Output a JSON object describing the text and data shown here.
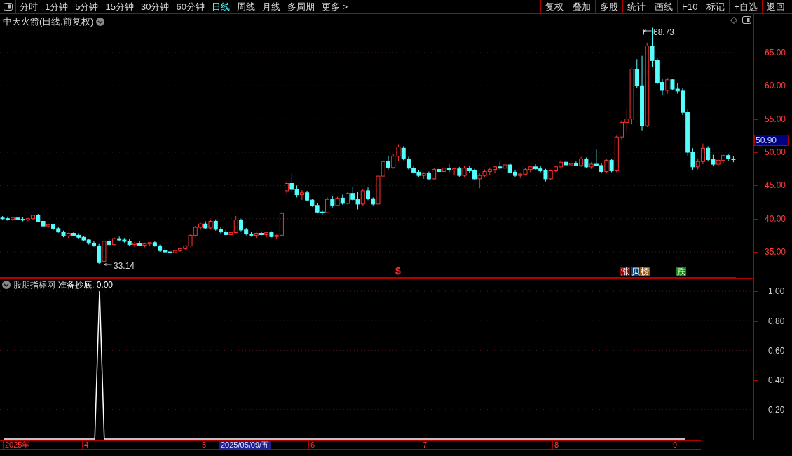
{
  "toolbar": {
    "periods": [
      {
        "label": "分时",
        "selected": false
      },
      {
        "label": "1分钟",
        "selected": false
      },
      {
        "label": "5分钟",
        "selected": false
      },
      {
        "label": "15分钟",
        "selected": false
      },
      {
        "label": "30分钟",
        "selected": false
      },
      {
        "label": "60分钟",
        "selected": false
      },
      {
        "label": "日线",
        "selected": true
      },
      {
        "label": "周线",
        "selected": false
      },
      {
        "label": "月线",
        "selected": false
      },
      {
        "label": "多周期",
        "selected": false
      },
      {
        "label": "更多 >",
        "selected": false
      }
    ],
    "actions": [
      "复权",
      "叠加",
      "多股",
      "统计",
      "画线",
      "F10",
      "标记",
      "+自选",
      "返回"
    ]
  },
  "main_chart": {
    "title": "中天火箭(日线.前复权)",
    "current_price": "50.90",
    "high_label": "68.73",
    "low_label": "33.14",
    "markers": [
      {
        "kind": "plain",
        "text": "$",
        "color": "#ff3030"
      },
      {
        "kind": "badge",
        "text": "涨",
        "color": "#8b0a0a"
      },
      {
        "kind": "badge",
        "text": "贝",
        "color": "#0a3f78"
      },
      {
        "kind": "badge",
        "text": "榜",
        "color": "#a0520a"
      },
      {
        "kind": "badge",
        "text": "跌",
        "color": "#0a8a0a"
      }
    ],
    "chart_data": {
      "type": "candlestick",
      "ylim": [
        31.1,
        70.8
      ],
      "grid": true,
      "yticks": [
        {
          "value": 65,
          "label": "65.00"
        },
        {
          "value": 60,
          "label": "60.00"
        },
        {
          "value": 55,
          "label": "55.00"
        },
        {
          "value": 50,
          "label": "50.00"
        },
        {
          "value": 45,
          "label": "45.00"
        },
        {
          "value": 40,
          "label": "40.00"
        },
        {
          "value": 35,
          "label": "35.00"
        }
      ],
      "categories": [
        null,
        null,
        null,
        null,
        null,
        null,
        null,
        null,
        null,
        null,
        null,
        null,
        null,
        null,
        null,
        null,
        null,
        null,
        null,
        null,
        null,
        null,
        null,
        null,
        null,
        null,
        null,
        null,
        null,
        null,
        null,
        null,
        null,
        null,
        null,
        null,
        null,
        null,
        null,
        null,
        null,
        null,
        null,
        null,
        null,
        null,
        null,
        null,
        null,
        null,
        null,
        null,
        null,
        null,
        null,
        null,
        null,
        null,
        null,
        null,
        null,
        null,
        null,
        null,
        null,
        null,
        null,
        null,
        null,
        null,
        null,
        null,
        null,
        null,
        null,
        null,
        null,
        null,
        null,
        null,
        null,
        null,
        null,
        null,
        null,
        null,
        null,
        null,
        null,
        null,
        null,
        null,
        null,
        null,
        null,
        null,
        null,
        null,
        null,
        null,
        null,
        null,
        null,
        null,
        null,
        null,
        null,
        null,
        null,
        null,
        null,
        null,
        null,
        null,
        null,
        null,
        null,
        null,
        null,
        null,
        null,
        null,
        null,
        null,
        null,
        null,
        null,
        null,
        null,
        null,
        null,
        null,
        null,
        null,
        null,
        null,
        null,
        null,
        null,
        null,
        null,
        null,
        null,
        null,
        null
      ],
      "ohlc": [
        [
          40.1,
          40.4,
          39.8,
          40.0
        ],
        [
          40.0,
          40.3,
          39.7,
          39.9
        ],
        [
          39.9,
          40.2,
          39.7,
          40.1
        ],
        [
          40.1,
          40.3,
          39.8,
          39.9
        ],
        [
          39.9,
          40.2,
          39.6,
          39.8
        ],
        [
          39.8,
          40.1,
          39.6,
          40.0
        ],
        [
          40.0,
          40.6,
          39.8,
          40.5
        ],
        [
          40.5,
          40.7,
          39.5,
          39.6
        ],
        [
          39.6,
          39.9,
          38.7,
          38.9
        ],
        [
          38.9,
          39.3,
          38.6,
          39.1
        ],
        [
          39.1,
          39.2,
          38.3,
          38.5
        ],
        [
          38.5,
          38.8,
          37.9,
          38.0
        ],
        [
          38.0,
          38.2,
          37.2,
          37.4
        ],
        [
          37.4,
          37.9,
          37.1,
          37.8
        ],
        [
          37.8,
          38.0,
          37.3,
          37.5
        ],
        [
          37.5,
          37.8,
          37.0,
          37.2
        ],
        [
          37.2,
          37.4,
          36.6,
          36.8
        ],
        [
          36.8,
          37.0,
          36.1,
          36.3
        ],
        [
          36.3,
          36.6,
          35.8,
          35.9
        ],
        [
          35.9,
          36.2,
          33.14,
          33.4
        ],
        [
          33.6,
          36.8,
          33.5,
          36.6
        ],
        [
          36.6,
          37.0,
          35.9,
          36.1
        ],
        [
          36.1,
          37.2,
          35.9,
          37.0
        ],
        [
          37.0,
          37.3,
          36.6,
          36.8
        ],
        [
          36.8,
          37.1,
          36.4,
          36.6
        ],
        [
          36.6,
          36.9,
          35.9,
          36.1
        ],
        [
          36.1,
          36.5,
          35.8,
          36.3
        ],
        [
          36.3,
          36.6,
          35.9,
          36.0
        ],
        [
          36.0,
          36.4,
          35.7,
          36.2
        ],
        [
          36.2,
          36.5,
          35.9,
          36.4
        ],
        [
          36.4,
          36.6,
          35.8,
          35.9
        ],
        [
          35.9,
          36.1,
          35.0,
          35.2
        ],
        [
          35.2,
          35.5,
          34.8,
          35.0
        ],
        [
          35.0,
          35.3,
          34.7,
          34.9
        ],
        [
          34.9,
          35.3,
          34.8,
          35.2
        ],
        [
          35.2,
          35.6,
          35.0,
          35.5
        ],
        [
          35.5,
          36.0,
          35.3,
          35.9
        ],
        [
          35.9,
          37.6,
          35.8,
          37.5
        ],
        [
          37.5,
          38.9,
          37.3,
          38.7
        ],
        [
          38.7,
          39.4,
          38.3,
          39.2
        ],
        [
          39.2,
          39.6,
          38.4,
          38.6
        ],
        [
          38.6,
          39.8,
          38.4,
          39.6
        ],
        [
          39.6,
          39.9,
          38.2,
          38.4
        ],
        [
          38.4,
          38.7,
          37.8,
          38.0
        ],
        [
          38.0,
          38.3,
          37.5,
          37.6
        ],
        [
          37.6,
          38.1,
          37.4,
          37.9
        ],
        [
          37.9,
          40.4,
          37.8,
          39.8
        ],
        [
          39.8,
          40.0,
          38.1,
          38.3
        ],
        [
          38.3,
          38.6,
          37.5,
          37.7
        ],
        [
          37.7,
          38.0,
          37.3,
          37.5
        ],
        [
          37.5,
          37.9,
          37.1,
          37.8
        ],
        [
          37.8,
          38.1,
          37.5,
          37.6
        ],
        [
          37.6,
          38.0,
          37.2,
          37.9
        ],
        [
          37.9,
          38.1,
          37.2,
          37.3
        ],
        [
          37.3,
          37.6,
          37.0,
          37.5
        ],
        [
          37.5,
          41.0,
          37.4,
          40.8
        ],
        [
          44.2,
          45.6,
          43.8,
          45.3
        ],
        [
          45.3,
          46.8,
          44.0,
          44.4
        ],
        [
          44.4,
          45.0,
          43.2,
          43.6
        ],
        [
          43.6,
          44.3,
          42.8,
          43.9
        ],
        [
          43.9,
          44.2,
          42.6,
          42.8
        ],
        [
          42.8,
          43.0,
          41.8,
          42.0
        ],
        [
          42.0,
          42.3,
          40.8,
          41.0
        ],
        [
          41.0,
          41.3,
          40.6,
          40.9
        ],
        [
          40.9,
          43.2,
          40.8,
          42.9
        ],
        [
          42.9,
          43.4,
          41.7,
          42.0
        ],
        [
          42.0,
          43.3,
          41.9,
          43.1
        ],
        [
          43.1,
          43.6,
          42.1,
          42.3
        ],
        [
          42.3,
          44.0,
          42.1,
          43.8
        ],
        [
          43.8,
          44.8,
          42.7,
          42.9
        ],
        [
          42.9,
          44.0,
          41.4,
          42.2
        ],
        [
          42.2,
          44.5,
          41.9,
          44.2
        ],
        [
          44.2,
          44.7,
          42.8,
          43.0
        ],
        [
          43.0,
          43.2,
          42.0,
          42.2
        ],
        [
          42.2,
          46.6,
          42.1,
          46.4
        ],
        [
          46.4,
          48.8,
          46.2,
          48.6
        ],
        [
          48.6,
          49.5,
          47.4,
          47.7
        ],
        [
          47.7,
          49.8,
          47.5,
          49.4
        ],
        [
          49.4,
          51.2,
          48.6,
          50.8
        ],
        [
          50.6,
          50.9,
          48.8,
          49.0
        ],
        [
          49.0,
          49.3,
          47.4,
          47.6
        ],
        [
          47.6,
          48.0,
          46.8,
          47.0
        ],
        [
          47.0,
          47.3,
          46.3,
          46.5
        ],
        [
          46.5,
          47.0,
          46.0,
          46.8
        ],
        [
          46.8,
          47.1,
          45.8,
          46.0
        ],
        [
          46.0,
          47.6,
          45.8,
          47.4
        ],
        [
          47.4,
          47.8,
          46.9,
          47.1
        ],
        [
          47.1,
          47.9,
          46.8,
          47.6
        ],
        [
          47.6,
          48.2,
          47.0,
          47.3
        ],
        [
          47.3,
          47.7,
          46.6,
          47.5
        ],
        [
          47.5,
          47.8,
          46.3,
          46.5
        ],
        [
          46.5,
          47.9,
          46.2,
          47.6
        ],
        [
          47.6,
          48.0,
          46.9,
          47.2
        ],
        [
          47.2,
          47.5,
          45.8,
          46.0
        ],
        [
          46.0,
          46.8,
          44.6,
          46.5
        ],
        [
          46.5,
          47.4,
          46.2,
          47.1
        ],
        [
          47.1,
          47.7,
          46.6,
          47.4
        ],
        [
          47.4,
          48.0,
          46.9,
          47.8
        ],
        [
          47.8,
          48.6,
          47.3,
          47.6
        ],
        [
          47.6,
          48.4,
          47.2,
          48.1
        ],
        [
          48.1,
          48.3,
          46.9,
          47.0
        ],
        [
          47.0,
          47.3,
          46.3,
          46.5
        ],
        [
          46.5,
          46.9,
          46.1,
          46.7
        ],
        [
          46.7,
          47.6,
          46.5,
          47.4
        ],
        [
          47.4,
          48.0,
          47.0,
          47.8
        ],
        [
          47.8,
          48.2,
          47.3,
          47.5
        ],
        [
          47.5,
          48.0,
          47.0,
          47.2
        ],
        [
          47.2,
          47.5,
          45.6,
          46.0
        ],
        [
          46.0,
          47.4,
          45.8,
          47.2
        ],
        [
          47.2,
          48.0,
          47.0,
          47.8
        ],
        [
          47.8,
          48.8,
          47.5,
          48.5
        ],
        [
          48.5,
          48.9,
          47.9,
          48.1
        ],
        [
          48.1,
          48.5,
          47.8,
          48.3
        ],
        [
          48.3,
          48.6,
          47.9,
          48.0
        ],
        [
          48.0,
          49.3,
          47.8,
          49.0
        ],
        [
          49.0,
          49.2,
          47.6,
          47.8
        ],
        [
          47.8,
          48.5,
          47.5,
          48.2
        ],
        [
          48.2,
          50.4,
          47.9,
          48.0
        ],
        [
          48.0,
          48.3,
          46.8,
          47.1
        ],
        [
          47.1,
          49.0,
          46.9,
          48.8
        ],
        [
          48.8,
          49.0,
          47.0,
          47.2
        ],
        [
          47.2,
          52.5,
          47.0,
          52.3
        ],
        [
          52.3,
          54.8,
          51.8,
          54.5
        ],
        [
          54.5,
          56.5,
          53.0,
          55.0
        ],
        [
          55.0,
          62.6,
          54.2,
          62.5
        ],
        [
          62.5,
          64.0,
          59.6,
          60.0
        ],
        [
          60.0,
          64.5,
          53.2,
          54.0
        ],
        [
          54.0,
          66.5,
          53.8,
          66.0
        ],
        [
          66.0,
          68.73,
          62.8,
          63.8
        ],
        [
          63.8,
          64.2,
          60.2,
          60.5
        ],
        [
          60.5,
          61.0,
          58.6,
          59.3
        ],
        [
          59.3,
          61.2,
          58.8,
          60.9
        ],
        [
          60.9,
          61.0,
          59.3,
          59.5
        ],
        [
          59.5,
          60.4,
          58.8,
          59.2
        ],
        [
          59.2,
          59.6,
          55.6,
          56.0
        ],
        [
          56.0,
          56.4,
          49.5,
          50.0
        ],
        [
          50.0,
          50.6,
          47.3,
          47.8
        ],
        [
          47.8,
          49.0,
          47.4,
          48.6
        ],
        [
          48.6,
          51.3,
          48.2,
          50.6
        ],
        [
          50.6,
          50.9,
          48.6,
          48.9
        ],
        [
          48.9,
          49.6,
          47.9,
          48.2
        ],
        [
          48.2,
          49.0,
          47.7,
          48.8
        ],
        [
          48.8,
          49.7,
          48.3,
          49.5
        ],
        [
          49.5,
          49.8,
          48.7,
          49.0
        ],
        [
          49.0,
          49.4,
          48.5,
          48.9
        ]
      ]
    }
  },
  "indicator": {
    "source": "股朋指标网",
    "reading": ": 0.00",
    "chart_data": {
      "type": "line",
      "categories": [
        null,
        null,
        null,
        null,
        null,
        null,
        null,
        null,
        null,
        null,
        null,
        null,
        null,
        null,
        null,
        null,
        null,
        null,
        null,
        null,
        null,
        null,
        null,
        null,
        null,
        null,
        null,
        null,
        null,
        null,
        null,
        null,
        null,
        null,
        null,
        null,
        null,
        null,
        null,
        null,
        null,
        null,
        null,
        null,
        null,
        null,
        null,
        null,
        null,
        null,
        null,
        null,
        null,
        null,
        null,
        null,
        null,
        null,
        null,
        null,
        null,
        null,
        null,
        null,
        null,
        null,
        null,
        null,
        null,
        null,
        null,
        null,
        null,
        null,
        null,
        null,
        null,
        null,
        null,
        null,
        null,
        null,
        null,
        null,
        null,
        null,
        null,
        null,
        null,
        null,
        null,
        null,
        null,
        null,
        null,
        null,
        null,
        null,
        null,
        null,
        null,
        null,
        null,
        null,
        null,
        null,
        null,
        null,
        null,
        null,
        null,
        null,
        null,
        null,
        null,
        null,
        null,
        null,
        null,
        null,
        null,
        null,
        null,
        null,
        null,
        null,
        null,
        null,
        null,
        null,
        null,
        null,
        null,
        null,
        null,
        null,
        null,
        null,
        null,
        null,
        null,
        null,
        null
      ],
      "series": [
        {
          "name": "准备抄底",
          "color": "#ffffff",
          "values": [
            0,
            0,
            0,
            0,
            0,
            0,
            0,
            0,
            0,
            0,
            0,
            0,
            0,
            0,
            0,
            0,
            0,
            0,
            0,
            0,
            1,
            0,
            0,
            0,
            0,
            0,
            0,
            0,
            0,
            0,
            0,
            0,
            0,
            0,
            0,
            0,
            0,
            0,
            0,
            0,
            0,
            0,
            0,
            0,
            0,
            0,
            0,
            0,
            0,
            0,
            0,
            0,
            0,
            0,
            0,
            0,
            0,
            0,
            0,
            0,
            0,
            0,
            0,
            0,
            0,
            0,
            0,
            0,
            0,
            0,
            0,
            0,
            0,
            0,
            0,
            0,
            0,
            0,
            0,
            0,
            0,
            0,
            0,
            0,
            0,
            0,
            0,
            0,
            0,
            0,
            0,
            0,
            0,
            0,
            0,
            0,
            0,
            0,
            0,
            0,
            0,
            0,
            0,
            0,
            0,
            0,
            0,
            0,
            0,
            0,
            0,
            0,
            0,
            0,
            0,
            0,
            0,
            0,
            0,
            0,
            0,
            0,
            0,
            0,
            0,
            0,
            0,
            0,
            0,
            0,
            0,
            0,
            0,
            0,
            0,
            0,
            0,
            0,
            0,
            0,
            0,
            0,
            0
          ]
        }
      ],
      "ylim": [
        0,
        1.09
      ],
      "grid": true,
      "yticks": [
        {
          "value": 1,
          "label": "1.00"
        },
        {
          "value": 0.8,
          "label": "0.80"
        },
        {
          "value": 0.6,
          "label": "0.60"
        },
        {
          "value": 0.4,
          "label": "0.40"
        },
        {
          "value": 0.2,
          "label": "0.20"
        }
      ]
    }
  },
  "date_axis": [
    {
      "label": "2025年",
      "selected": false
    },
    {
      "label": "4",
      "selected": false
    },
    {
      "label": "5",
      "selected": false
    },
    {
      "label": "2025/05/09/五",
      "selected": true
    },
    {
      "label": "6",
      "selected": false
    },
    {
      "label": "7",
      "selected": false
    },
    {
      "label": "8",
      "selected": false
    },
    {
      "label": "9",
      "selected": false
    }
  ]
}
